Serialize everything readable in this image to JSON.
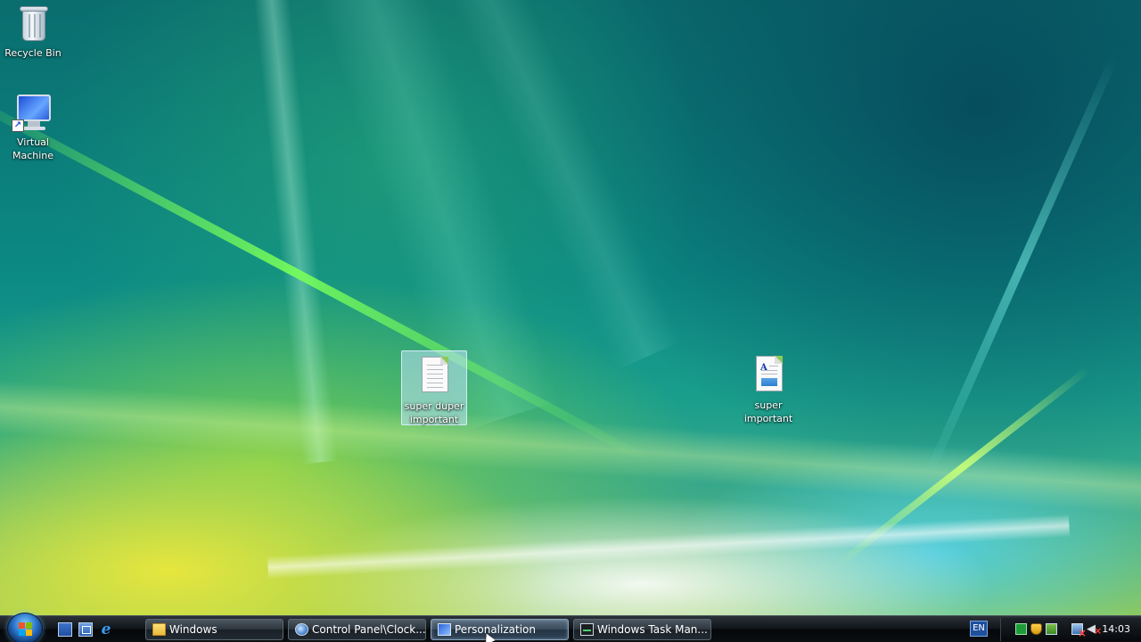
{
  "desktop": {
    "icons": [
      {
        "label": "Recycle Bin",
        "icon": "recycle-bin-icon"
      },
      {
        "label": "Virtual Machine",
        "icon": "virtual-machine-icon"
      },
      {
        "label": "super duper important",
        "icon": "text-document-icon",
        "selected": true
      },
      {
        "label": "super important",
        "icon": "wordpad-document-icon"
      }
    ],
    "document_glyph": "A"
  },
  "taskbar": {
    "start_icon": "windows-start-orb",
    "quick_launch": [
      {
        "icon": "show-desktop-icon"
      },
      {
        "icon": "switch-windows-icon"
      },
      {
        "icon": "internet-explorer-icon",
        "glyph": "e"
      }
    ],
    "tasks": [
      {
        "label": "Windows",
        "icon": "folder-icon",
        "active": false
      },
      {
        "label": "Control Panel\\Clock...",
        "icon": "control-panel-icon",
        "active": false
      },
      {
        "label": "Personalization",
        "icon": "personalization-icon",
        "active": true
      },
      {
        "label": "Windows Task Man...",
        "icon": "task-manager-icon",
        "active": false
      }
    ],
    "language": "EN",
    "tray_icons": [
      "green-status-icon",
      "security-shield-icon",
      "network-app-icon",
      "network-disconnected-icon",
      "volume-muted-icon"
    ],
    "volume_glyph": "◀",
    "clock": "14:03"
  }
}
